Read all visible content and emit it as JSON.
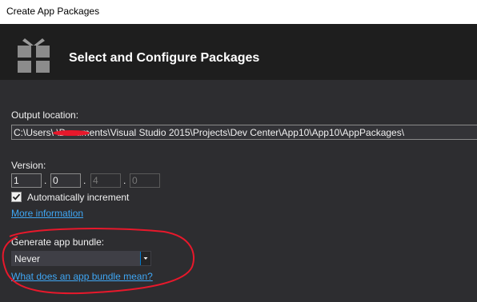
{
  "window": {
    "title": "Create App Packages"
  },
  "header": {
    "title": "Select and Configure Packages",
    "icon": "package-gift-icon"
  },
  "output": {
    "label": "Output location:",
    "value": "C:\\Users\\ \\Documents\\Visual Studio 2015\\Projects\\Dev Center\\App10\\App10\\AppPackages\\"
  },
  "version": {
    "label": "Version:",
    "parts": [
      "1",
      "0",
      "4",
      "0"
    ]
  },
  "auto_increment": {
    "label": "Automatically increment",
    "checked": true
  },
  "more_info": {
    "label": "More information"
  },
  "bundle": {
    "label": "Generate app bundle:",
    "selected": "Never",
    "help_link": "What does an app bundle mean?"
  },
  "annotation": {
    "color": "#e8182b"
  }
}
